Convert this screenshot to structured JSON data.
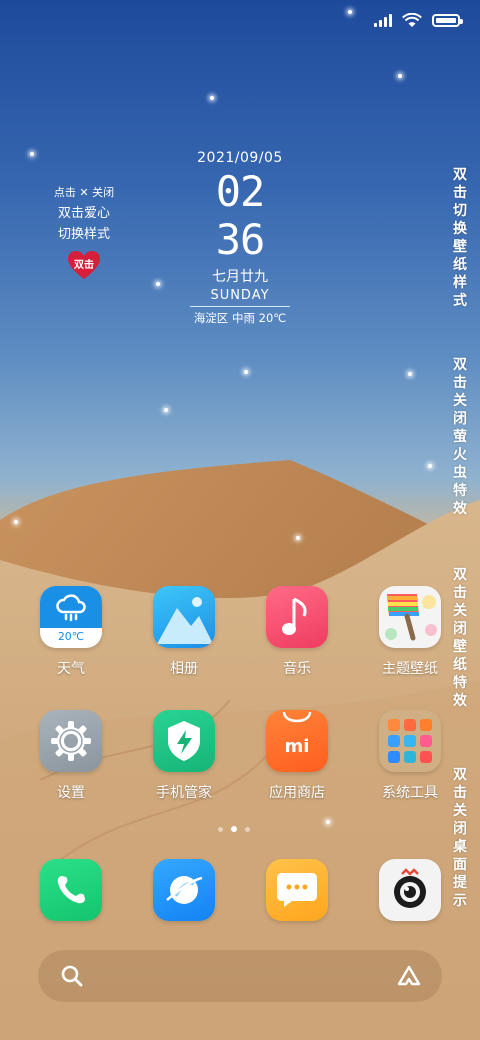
{
  "status_bar": {
    "icons": [
      "signal-icon",
      "wifi-icon",
      "battery-icon"
    ],
    "battery_level": 1.0
  },
  "heart_widget": {
    "line1": "点击 ✕ 关闭",
    "line2": "双击爱心",
    "line3": "切换样式",
    "button_label": "双击"
  },
  "clock": {
    "date": "2021/09/05",
    "time": "02 36",
    "lunar": "七月廿九",
    "weekday": "SUNDAY",
    "weather": "海淀区 中雨 20℃"
  },
  "side_texts": [
    "双击切换壁纸样式",
    "双击关闭萤火虫特效",
    "双击关闭壁纸特效",
    "双击关闭桌面提示"
  ],
  "apps": [
    {
      "label": "天气",
      "icon": "weather-icon",
      "temp": "20℃"
    },
    {
      "label": "相册",
      "icon": "gallery-icon"
    },
    {
      "label": "音乐",
      "icon": "music-icon"
    },
    {
      "label": "主题壁纸",
      "icon": "themes-icon"
    },
    {
      "label": "设置",
      "icon": "settings-icon"
    },
    {
      "label": "手机管家",
      "icon": "security-icon"
    },
    {
      "label": "应用商店",
      "icon": "app-store-icon"
    },
    {
      "label": "系统工具",
      "icon": "folder-icon"
    }
  ],
  "page_indicator": {
    "pages": 3,
    "current": 2
  },
  "dock": [
    "phone-icon",
    "browser-icon",
    "messages-icon",
    "camera-icon"
  ],
  "search_bar": {
    "icons": [
      "search-icon",
      "assistant-icon"
    ]
  },
  "colors": {
    "weather": "#1a8fe6",
    "gallery": "#29a7f0",
    "music": "#f0486b",
    "settings": "#9aa5ae",
    "security": "#1fc486",
    "app_store": "#ff6e2a",
    "phone": "#20d07b",
    "browser": "#1e96ff",
    "messages": "#ffb22e"
  }
}
